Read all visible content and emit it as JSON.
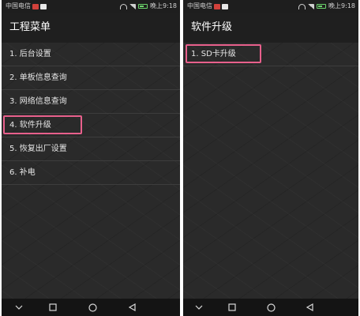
{
  "left_screen": {
    "status": {
      "carrier": "中国电信",
      "time": "晚上9:18"
    },
    "title": "工程菜单",
    "items": [
      {
        "label": "1. 后台设置"
      },
      {
        "label": "2. 单板信息查询"
      },
      {
        "label": "3. 网络信息查询"
      },
      {
        "label": "4. 软件升级",
        "highlighted": true
      },
      {
        "label": "5. 恢复出厂设置"
      },
      {
        "label": "6. 补电"
      }
    ]
  },
  "right_screen": {
    "status": {
      "carrier": "中国电信",
      "time": "晚上9:18"
    },
    "title": "软件升级",
    "items": [
      {
        "label": "1. SD卡升级",
        "highlighted": true
      }
    ]
  },
  "highlight_color": "#e8608c",
  "nav": {
    "icons": [
      "chevron-down-icon",
      "square-recent-icon",
      "circle-home-icon",
      "triangle-back-icon"
    ]
  }
}
